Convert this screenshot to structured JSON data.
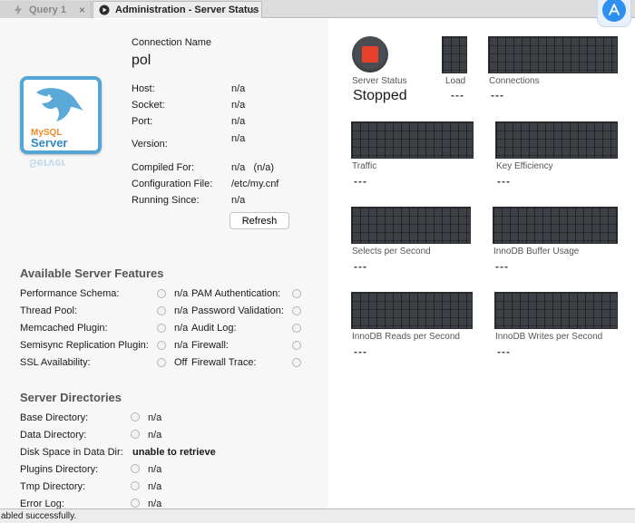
{
  "tabs": [
    {
      "label": "Query 1",
      "close": "×"
    },
    {
      "label": "Administration - Server Status",
      "close": "×"
    }
  ],
  "connection": {
    "name_label": "Connection Name",
    "name": "pol",
    "rows": [
      {
        "label": "Host:",
        "value": "n/a"
      },
      {
        "label": "Socket:",
        "value": "n/a"
      },
      {
        "label": "Port:",
        "value": "n/a"
      },
      {
        "label": "Version:",
        "value": "n/a"
      },
      {
        "label": "Compiled For:",
        "value": "n/a   (n/a)"
      },
      {
        "label": "Configuration File:",
        "value": "/etc/my.cnf"
      },
      {
        "label": "Running Since:",
        "value": "n/a"
      }
    ],
    "refresh_label": "Refresh"
  },
  "logo": {
    "line1": "MySQL",
    "line2": "Server"
  },
  "features": {
    "title": "Available Server Features",
    "left": [
      {
        "label": "Performance Schema:",
        "value": "n/a"
      },
      {
        "label": "Thread Pool:",
        "value": "n/a"
      },
      {
        "label": "Memcached Plugin:",
        "value": "n/a"
      },
      {
        "label": "Semisync Replication Plugin:",
        "value": "n/a"
      },
      {
        "label": "SSL Availability:",
        "value": "Off"
      }
    ],
    "right": [
      {
        "label": "PAM Authentication:"
      },
      {
        "label": "Password Validation:"
      },
      {
        "label": "Audit Log:"
      },
      {
        "label": "Firewall:"
      },
      {
        "label": "Firewall Trace:"
      }
    ]
  },
  "directories": {
    "title": "Server Directories",
    "rows": [
      {
        "label": "Base Directory:",
        "value": "n/a"
      },
      {
        "label": "Data Directory:",
        "value": "n/a"
      },
      {
        "label": "Disk Space in Data Dir:",
        "value": "unable to retrieve"
      },
      {
        "label": "Plugins Directory:",
        "value": "n/a"
      },
      {
        "label": "Tmp Directory:",
        "value": "n/a"
      },
      {
        "label": "Error Log:",
        "value": "n/a"
      }
    ]
  },
  "server_status": {
    "label": "Server Status",
    "value": "Stopped"
  },
  "metrics": {
    "load": {
      "label": "Load",
      "value": "---"
    },
    "connections": {
      "label": "Connections",
      "value": "---"
    },
    "traffic": {
      "label": "Traffic",
      "value": "---"
    },
    "key_efficiency": {
      "label": "Key Efficiency",
      "value": "---"
    },
    "selects_per_second": {
      "label": "Selects per Second",
      "value": "---"
    },
    "innodb_buffer_usage": {
      "label": "InnoDB Buffer Usage",
      "value": "---"
    },
    "innodb_reads": {
      "label": "InnoDB Reads per Second",
      "value": "---"
    },
    "innodb_writes": {
      "label": "InnoDB Writes per Second",
      "value": "---"
    }
  },
  "statusbar": {
    "message": "abled successfully."
  },
  "colors": {
    "stop_red": "#e8402b",
    "graph_bg": "#3d4146",
    "logo_blue": "#53a7d6"
  },
  "icons": [
    "lightning-icon",
    "close-icon",
    "admin-tab-icon",
    "app-store-icon",
    "mysql-dolphin-logo",
    "radio-indicator-icon",
    "stop-icon"
  ]
}
